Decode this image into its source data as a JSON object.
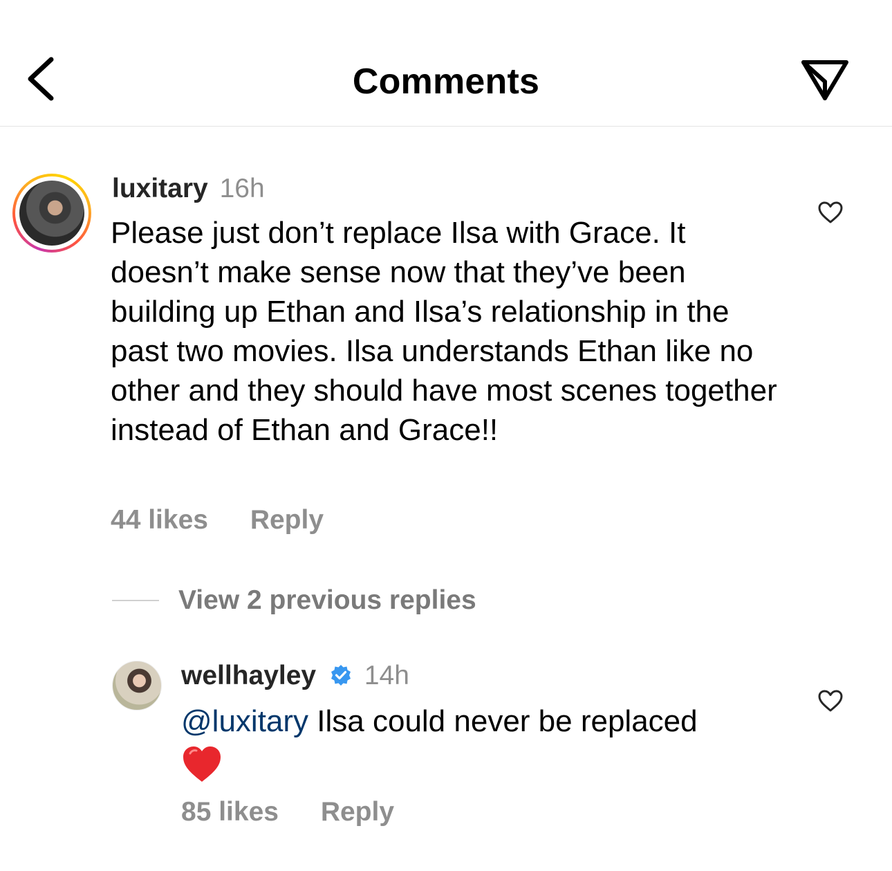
{
  "header": {
    "title": "Comments",
    "back_icon": "chevron-left-icon",
    "share_icon": "paper-plane-icon"
  },
  "comment": {
    "username": "luxitary",
    "time": "16h",
    "text": "Please just don’t replace Ilsa with Grace. It doesn’t make sense now that they’ve been building up Ethan and Ilsa’s relationship in the past two movies. Ilsa understands Ethan like no other and they should have most scenes together instead of Ethan and Grace!!",
    "likes": "44 likes",
    "reply_label": "Reply"
  },
  "view_previous": "View 2 previous replies",
  "reply": {
    "username": "wellhayley",
    "verified": true,
    "time": "14h",
    "mention": "@luxitary",
    "text": " Ilsa could never be replaced",
    "emoji": "❤️",
    "likes": "85 likes",
    "reply_label": "Reply"
  },
  "colors": {
    "verified_blue": "#3897f0",
    "mention": "#00376b",
    "muted": "#8e8e8e",
    "heart_red": "#ed4956"
  }
}
